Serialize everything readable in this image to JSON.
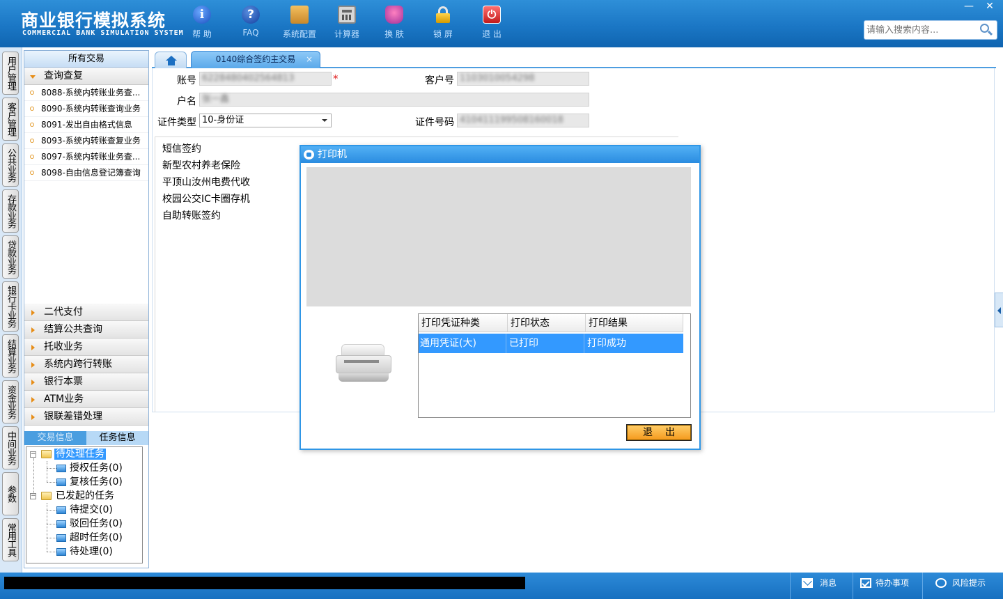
{
  "header": {
    "title_cn": "商业银行模拟系统",
    "title_en": "COMMERCIAL BANK SIMULATION SYSTEM",
    "tools": [
      {
        "label": "帮 助",
        "icon": "info-icon"
      },
      {
        "label": "FAQ",
        "icon": "faq-icon"
      },
      {
        "label": "系统配置",
        "icon": "toolbox-icon"
      },
      {
        "label": "计算器",
        "icon": "calculator-icon"
      },
      {
        "label": "换 肤",
        "icon": "tshirt-icon"
      },
      {
        "label": "锁 屏",
        "icon": "lock-icon"
      },
      {
        "label": "退 出",
        "icon": "power-icon"
      }
    ],
    "help_glyph": "i",
    "faq_glyph": "?",
    "exit_glyph": "⏻",
    "search_placeholder": "请输入搜索内容...",
    "min_glyph": "—",
    "close_glyph": "✕"
  },
  "vertical_tabs": [
    "用户管理",
    "客户管理",
    "公共业务",
    "存款业务",
    "贷款业务",
    "银行卡业务",
    "结算业务",
    "资金业务",
    "中间业务",
    "参数",
    "常用工具"
  ],
  "sidebar": {
    "title": "所有交易",
    "open_category": "查询查复",
    "transactions": [
      "8088-系统内转账业务查...",
      "8090-系统内转账查询业务",
      "8091-发出自由格式信息",
      "8093-系统内转账查复业务",
      "8097-系统内转账业务查...",
      "8098-自由信息登记簿查询"
    ],
    "categories": [
      "二代支付",
      "结算公共查询",
      "托收业务",
      "系统内跨行转账",
      "银行本票",
      "ATM业务",
      "银联差错处理"
    ],
    "info_tabs": [
      "交易信息",
      "任务信息"
    ],
    "tree": {
      "pending": "待处理任务",
      "auth": "授权任务(0)",
      "review": "复核任务(0)",
      "initiated": "已发起的任务",
      "to_submit": "待提交(0)",
      "rejected": "驳回任务(0)",
      "timeout": "超时任务(0)",
      "to_process": "待处理(0)",
      "minus": "−"
    }
  },
  "tabs": {
    "active": "0140综合签约主交易",
    "close": "×"
  },
  "form": {
    "account_label": "账号",
    "account_value": "6228480402564813",
    "required_mark": "*",
    "customer_no_label": "客户号",
    "customer_no_value": "1103010054298",
    "name_label": "户名",
    "name_value": "张一鑫",
    "id_type_label": "证件类型",
    "id_type_value": "10-身份证",
    "id_no_label": "证件号码",
    "id_no_value": "410411199508160018"
  },
  "services": [
    "短信签约",
    "新型农村养老保险",
    "平顶山汝州电费代收",
    "校园公交IC卡圈存机",
    "自助转账签约"
  ],
  "printer_dialog": {
    "title": "打印机",
    "columns": [
      "打印凭证种类",
      "打印状态",
      "打印结果"
    ],
    "rows": [
      [
        "通用凭证(大)",
        "已打印",
        "打印成功"
      ]
    ],
    "exit_button": "退出"
  },
  "statusbar": {
    "messages": "消息",
    "todo": "待办事项",
    "risk": "风险提示"
  }
}
